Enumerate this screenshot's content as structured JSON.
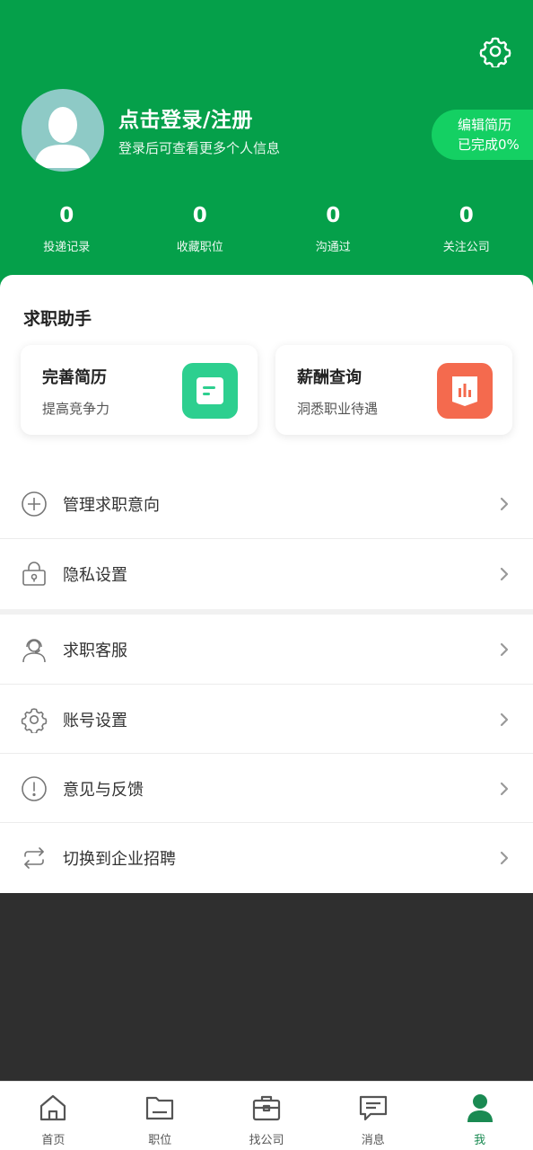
{
  "header": {
    "login_title": "点击登录/注册",
    "login_subtitle": "登录后可查看更多个人信息",
    "resume_line1": "编辑简历",
    "resume_line2": "已完成0%",
    "stats": [
      {
        "value": "0",
        "label": "投递记录"
      },
      {
        "value": "0",
        "label": "收藏职位"
      },
      {
        "value": "0",
        "label": "沟通过"
      },
      {
        "value": "0",
        "label": "关注公司"
      }
    ]
  },
  "assistant": {
    "title": "求职助手",
    "cards": [
      {
        "title": "完善简历",
        "subtitle": "提高竞争力",
        "icon": "document-icon",
        "color": "#2dcf8f"
      },
      {
        "title": "薪酬查询",
        "subtitle": "洞悉职业待遇",
        "icon": "bar-chart-icon",
        "color": "#f46a4e"
      }
    ]
  },
  "menu": [
    {
      "label": "管理求职意向",
      "icon": "plus-circle-icon"
    },
    {
      "label": "隐私设置",
      "icon": "lock-icon"
    },
    {
      "label": "求职客服",
      "icon": "headset-icon"
    },
    {
      "label": "账号设置",
      "icon": "gear-icon"
    },
    {
      "label": "意见与反馈",
      "icon": "exclamation-circle-icon"
    },
    {
      "label": "切换到企业招聘",
      "icon": "swap-icon"
    }
  ],
  "tabs": [
    {
      "label": "首页",
      "icon": "home-icon"
    },
    {
      "label": "职位",
      "icon": "folder-icon"
    },
    {
      "label": "找公司",
      "icon": "briefcase-icon"
    },
    {
      "label": "消息",
      "icon": "message-icon"
    },
    {
      "label": "我",
      "icon": "person-icon"
    }
  ],
  "colors": {
    "brand": "#05a04a",
    "pill": "#14d063",
    "active_tab": "#1a8a52"
  }
}
